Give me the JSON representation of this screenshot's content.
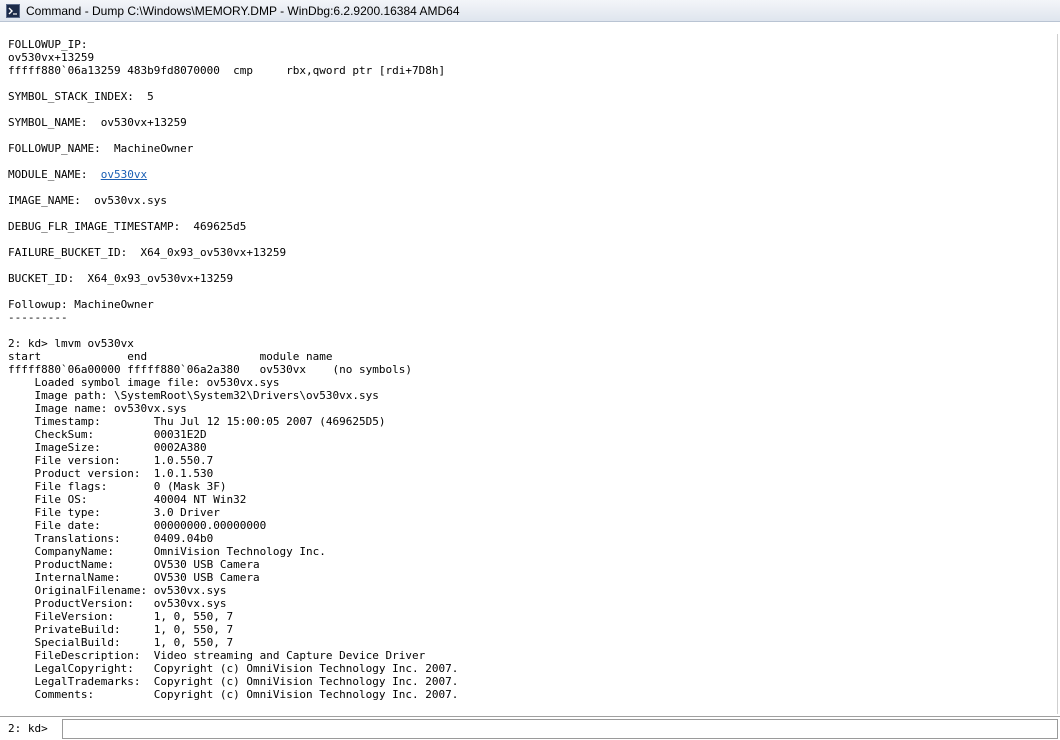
{
  "window": {
    "title": "Command - Dump C:\\Windows\\MEMORY.DMP - WinDbg:6.2.9200.16384 AMD64",
    "icon": "console-icon"
  },
  "output": {
    "lines": [
      {
        "text": "FOLLOWUP_IP:"
      },
      {
        "text": "ov530vx+13259"
      },
      {
        "text": "fffff880`06a13259 483b9fd8070000  cmp     rbx,qword ptr [rdi+7D8h]"
      },
      {
        "text": ""
      },
      {
        "text": "SYMBOL_STACK_INDEX:  5"
      },
      {
        "text": ""
      },
      {
        "text": "SYMBOL_NAME:  ov530vx+13259"
      },
      {
        "text": ""
      },
      {
        "text": "FOLLOWUP_NAME:  MachineOwner"
      },
      {
        "text": ""
      },
      {
        "text": "MODULE_NAME:  ",
        "link": "ov530vx"
      },
      {
        "text": ""
      },
      {
        "text": "IMAGE_NAME:  ov530vx.sys"
      },
      {
        "text": ""
      },
      {
        "text": "DEBUG_FLR_IMAGE_TIMESTAMP:  469625d5"
      },
      {
        "text": ""
      },
      {
        "text": "FAILURE_BUCKET_ID:  X64_0x93_ov530vx+13259"
      },
      {
        "text": ""
      },
      {
        "text": "BUCKET_ID:  X64_0x93_ov530vx+13259"
      },
      {
        "text": ""
      },
      {
        "text": "Followup: MachineOwner"
      },
      {
        "text": "---------"
      },
      {
        "text": ""
      },
      {
        "text": "2: kd> lmvm ov530vx"
      },
      {
        "text": "start             end                 module name"
      },
      {
        "text": "fffff880`06a00000 fffff880`06a2a380   ov530vx    (no symbols)"
      },
      {
        "text": "    Loaded symbol image file: ov530vx.sys"
      },
      {
        "text": "    Image path: \\SystemRoot\\System32\\Drivers\\ov530vx.sys"
      },
      {
        "text": "    Image name: ov530vx.sys"
      },
      {
        "text": "    Timestamp:        Thu Jul 12 15:00:05 2007 (469625D5)"
      },
      {
        "text": "    CheckSum:         00031E2D"
      },
      {
        "text": "    ImageSize:        0002A380"
      },
      {
        "text": "    File version:     1.0.550.7"
      },
      {
        "text": "    Product version:  1.0.1.530"
      },
      {
        "text": "    File flags:       0 (Mask 3F)"
      },
      {
        "text": "    File OS:          40004 NT Win32"
      },
      {
        "text": "    File type:        3.0 Driver"
      },
      {
        "text": "    File date:        00000000.00000000"
      },
      {
        "text": "    Translations:     0409.04b0"
      },
      {
        "text": "    CompanyName:      OmniVision Technology Inc."
      },
      {
        "text": "    ProductName:      OV530 USB Camera"
      },
      {
        "text": "    InternalName:     OV530 USB Camera"
      },
      {
        "text": "    OriginalFilename: ov530vx.sys"
      },
      {
        "text": "    ProductVersion:   ov530vx.sys"
      },
      {
        "text": "    FileVersion:      1, 0, 550, 7"
      },
      {
        "text": "    PrivateBuild:     1, 0, 550, 7"
      },
      {
        "text": "    SpecialBuild:     1, 0, 550, 7"
      },
      {
        "text": "    FileDescription:  Video streaming and Capture Device Driver"
      },
      {
        "text": "    LegalCopyright:   Copyright (c) OmniVision Technology Inc. 2007."
      },
      {
        "text": "    LegalTrademarks:  Copyright (c) OmniVision Technology Inc. 2007."
      },
      {
        "text": "    Comments:         Copyright (c) OmniVision Technology Inc. 2007."
      }
    ]
  },
  "command": {
    "prompt": "2: kd>",
    "value": ""
  }
}
